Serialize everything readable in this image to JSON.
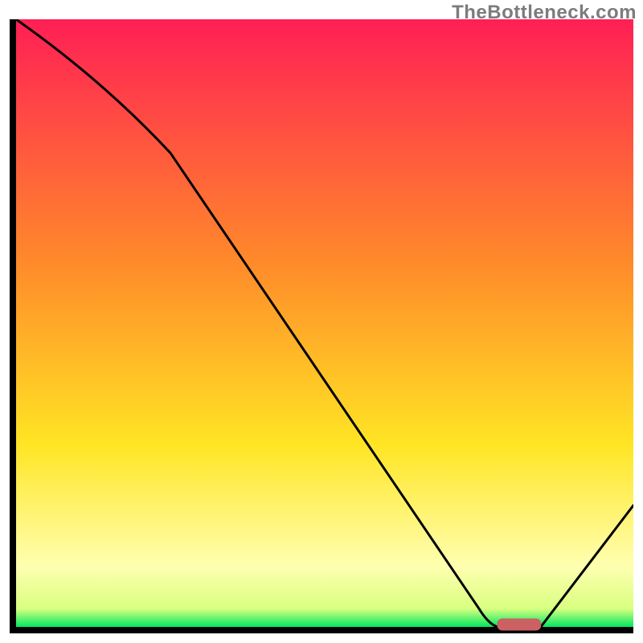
{
  "watermark": "TheBottleneck.com",
  "colors": {
    "gradient_top": "#ff1f55",
    "gradient_mid1": "#ff8a2a",
    "gradient_mid2": "#ffe524",
    "gradient_pale": "#ffffb0",
    "gradient_green": "#00e861",
    "axis": "#000000",
    "curve": "#000000",
    "marker_fill": "#cb6163",
    "marker_stroke": "#cb6163"
  },
  "chart_data": {
    "type": "line",
    "title": "",
    "xlabel": "",
    "ylabel": "",
    "xlim": [
      0,
      100
    ],
    "ylim": [
      0,
      100
    ],
    "x": [
      0,
      25,
      75,
      78,
      85,
      100
    ],
    "values": [
      100,
      78,
      3,
      0,
      0,
      20
    ],
    "optimal_range_x": [
      78,
      85
    ],
    "gradient_stops": [
      {
        "pos": 0.0,
        "color": "#ff1f55"
      },
      {
        "pos": 0.4,
        "color": "#ff8a2a"
      },
      {
        "pos": 0.7,
        "color": "#ffe524"
      },
      {
        "pos": 0.9,
        "color": "#ffffb0"
      },
      {
        "pos": 0.97,
        "color": "#d9ff80"
      },
      {
        "pos": 1.0,
        "color": "#00e861"
      }
    ]
  }
}
